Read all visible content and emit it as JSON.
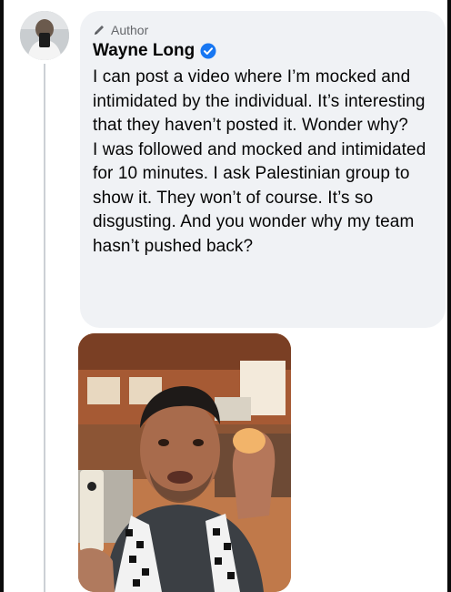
{
  "comment": {
    "badge_label": "Author",
    "author_name": "Wayne Long",
    "text": "I can post a video where I’m mocked and intimidated by the individual. It’s interesting that they haven’t posted it.  Wonder why?\nI was followed and mocked and intimidated for 10 minutes. I ask Palestinian group to show it. They won’t of course. It’s so disgusting. And you wonder why my team hasn’t pushed back?",
    "verified": true
  },
  "icons": {
    "badge": "pencil-icon",
    "verified": "verified-badge-icon"
  },
  "colors": {
    "bubble": "#f0f2f5",
    "verified_blue": "#1877f2",
    "secondary_text": "#65676b"
  }
}
